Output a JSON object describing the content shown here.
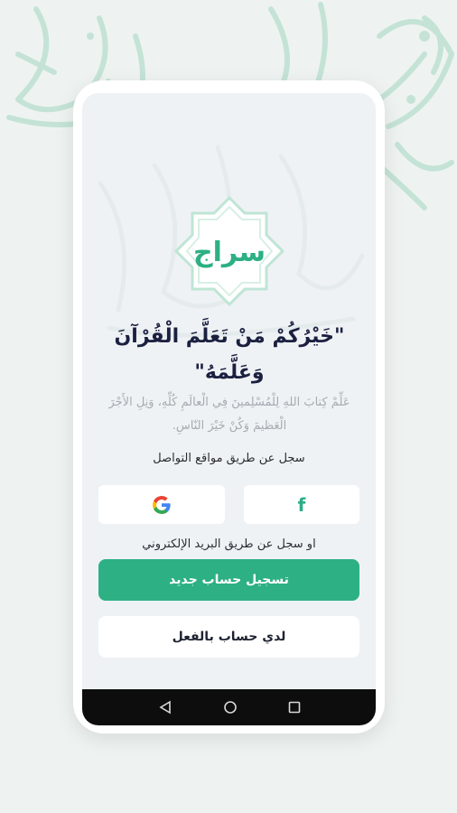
{
  "app": {
    "logo_text": "سراج"
  },
  "hero": {
    "quote_line1": "\"خَيْرُكُمْ مَنْ تَعَلَّمَ الْقُرْآنَ",
    "quote_line2": "وَعَلَّمَهُ\"",
    "description_line1": "عَلِّمْ كِتابَ اللهِ لِلْمُسْلِمينَ فِي الْعالَمِ كُلِّهِ، وَنِلِ الأَجْرَ",
    "description_line2": "الْعَظيمَ وَكُنْ خَيْرَ النّاسِ."
  },
  "auth": {
    "social_label": "سجل عن طريق مواقع التواصل",
    "email_label": "او سجل عن طريق البريد الإلكتروني",
    "register_button": "تسجيل حساب جديد",
    "login_button": "لدي حساب بالفعل"
  },
  "icons": {
    "facebook": "facebook-icon",
    "google": "google-icon",
    "back": "back-icon",
    "home": "home-icon",
    "recent": "recent-apps-icon"
  },
  "colors": {
    "brand_green": "#2db083",
    "background": "#eef3f1",
    "screen": "#eff2f5",
    "text_dark": "#1b2040",
    "text_muted": "#a7abb2"
  }
}
